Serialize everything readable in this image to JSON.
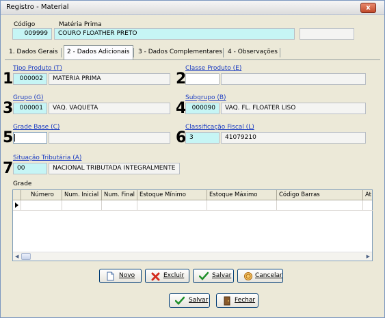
{
  "window": {
    "title": "Registro - Material",
    "close_label": "x"
  },
  "header": {
    "codigo_label": "Código",
    "codigo_value": "009999",
    "materia_label": "Matéria Prima",
    "materia_value": "COURO FLOATHER PRETO"
  },
  "tabs": [
    {
      "label": "1. Dados Gerais"
    },
    {
      "label": "2 - Dados Adicionais"
    },
    {
      "label": "3 - Dados Complementares"
    },
    {
      "label": "4 - Observações"
    }
  ],
  "fields": {
    "tipo_produto": {
      "label": "Tipo Produto (T)",
      "code": "000002",
      "desc": "MATERIA PRIMA",
      "marker": "1"
    },
    "classe_produto": {
      "label": "Classe Produto (E)",
      "code": "",
      "desc": "",
      "marker": "2"
    },
    "grupo": {
      "label": "Grupo (G)",
      "code": "000001",
      "desc": "VAQ. VAQUETA",
      "marker": "3"
    },
    "subgrupo": {
      "label": "Subgrupo (B)",
      "code": "000090",
      "desc": "VAQ. FL. FLOATER LISO",
      "marker": "4"
    },
    "grade_base": {
      "label": "Grade Base (C)",
      "code": "",
      "desc": "",
      "marker": "5"
    },
    "classificacao_fiscal": {
      "label": "Classificação Fiscal (L)",
      "code": "3",
      "desc": "41079210",
      "marker": "6"
    },
    "situacao_tributaria": {
      "label": "Situação Tributária (A)",
      "code": "00",
      "desc": "NACIONAL TRIBUTADA INTEGRALMENTE",
      "marker": "7"
    }
  },
  "grade": {
    "title": "Grade",
    "columns": [
      "Número",
      "Num. Inicial",
      "Num. Final",
      "Estoque Mínimo",
      "Estoque Máximo",
      "Código Barras",
      "At"
    ]
  },
  "grade_buttons": {
    "novo": "Novo",
    "excluir": "Excluir",
    "salvar": "Salvar",
    "cancelar": "Cancelar"
  },
  "footer_buttons": {
    "salvar": "Salvar",
    "fechar": "Fechar"
  },
  "colors": {
    "code_bg": "#c6f5f5",
    "link": "#1b3cc2",
    "window_bg": "#ece9d8"
  }
}
